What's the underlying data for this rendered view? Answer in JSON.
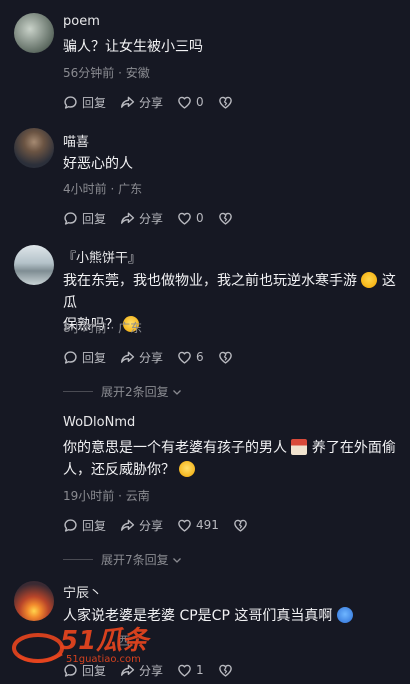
{
  "comments": [
    {
      "username": "poem",
      "text": "骗人？让女生被小三吗",
      "time": "56分钟前",
      "location": "安徽",
      "reply": "回复",
      "share": "分享",
      "likes": "0"
    },
    {
      "username": "喵喜",
      "text": "好恶心的人",
      "time": "4小时前",
      "location": "广东",
      "reply": "回复",
      "share": "分享",
      "likes": "0"
    },
    {
      "username": "『小熊饼干』",
      "text_line1": "我在东莞，我也做物业，我之前也玩逆水寒手游",
      "text_line1_end": "这瓜",
      "text_line2": "保熟吗？",
      "time": "8小时前",
      "location": "广东",
      "reply": "回复",
      "share": "分享",
      "likes": "6",
      "expand": "展开2条回复"
    },
    {
      "username": "WoDloNmd",
      "text_line1": "你的意思是一个有老婆有孩子的男人",
      "text_line1_end": "养了在外面偷",
      "text_line2": "人，还反威胁你？",
      "time": "19小时前",
      "location": "云南",
      "reply": "回复",
      "share": "分享",
      "likes": "491",
      "expand": "展开7条回复"
    },
    {
      "username": "宁辰丶",
      "text": "人家说老婆是老婆 CP是CP 这哥们真当真啊",
      "time": "",
      "location": "西",
      "reply": "回复",
      "share": "分享",
      "likes": "1"
    }
  ],
  "separator": "·",
  "watermark": {
    "brand": "51瓜条",
    "url": "51guatiao.com"
  },
  "colors": {
    "background": "#161823",
    "text": "#f2f2f4",
    "muted": "#8a8b91",
    "watermark": "#e8451e"
  }
}
